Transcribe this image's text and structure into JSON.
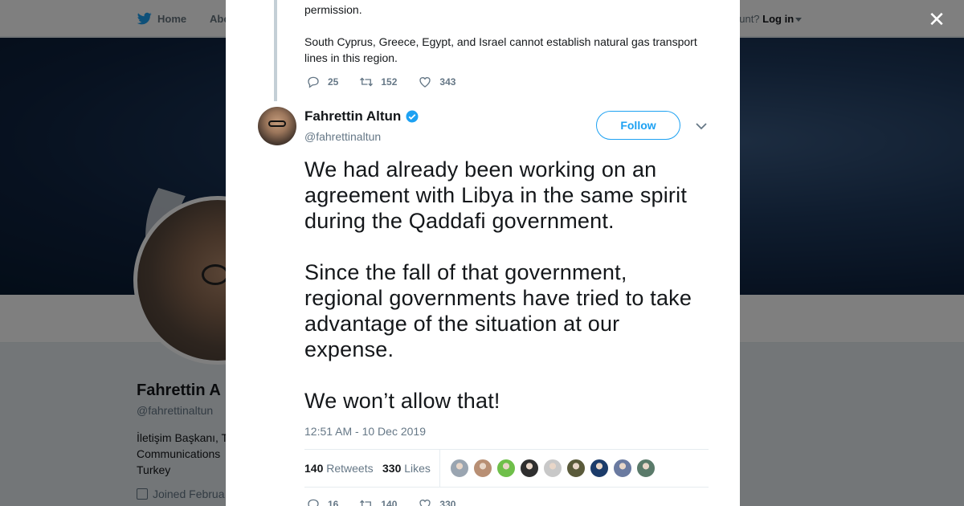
{
  "nav": {
    "home": "Home",
    "about": "Abo",
    "account_prompt": "ccount?",
    "login": "Log in"
  },
  "profile_bg": {
    "name": "Fahrettin A",
    "handle": "@fahrettinaltun",
    "bio_lines": [
      "İletişim Başkanı, T",
      "Communications",
      "Turkey"
    ],
    "joined": "Joined Februa"
  },
  "previous_tweet": {
    "text_1": "permission.",
    "text_2": "South Cyprus, Greece, Egypt, and Israel cannot establish natural gas transport lines in this region.",
    "replies": "25",
    "retweets": "152",
    "likes": "343"
  },
  "tweet": {
    "author_name": "Fahrettin Altun",
    "author_handle": "@fahrettinaltun",
    "follow_label": "Follow",
    "paragraphs": [
      "We had already been working on an agreement with Libya in the same spirit during the Qaddafi government.",
      "Since the fall of that government, regional governments have tried to take advantage of the situation at our expense.",
      "We won’t allow that!"
    ],
    "timestamp": "12:51 AM - 10 Dec 2019",
    "retweet_count": "140",
    "retweet_label": "Retweets",
    "like_count": "330",
    "like_label": "Likes",
    "replies": "16",
    "retweets": "140",
    "likes": "330"
  },
  "colors": {
    "accent": "#1da1f2",
    "overlay": "rgba(0,0,0,0.5)",
    "muted": "#657786"
  },
  "liker_avatars": [
    "#9aa5b1",
    "#b88f74",
    "#6fbf4a",
    "#2f2f2f",
    "#c8c8c8",
    "#5a5a3a",
    "#1c3c6a",
    "#6a7aa0",
    "#5a7a6a"
  ]
}
